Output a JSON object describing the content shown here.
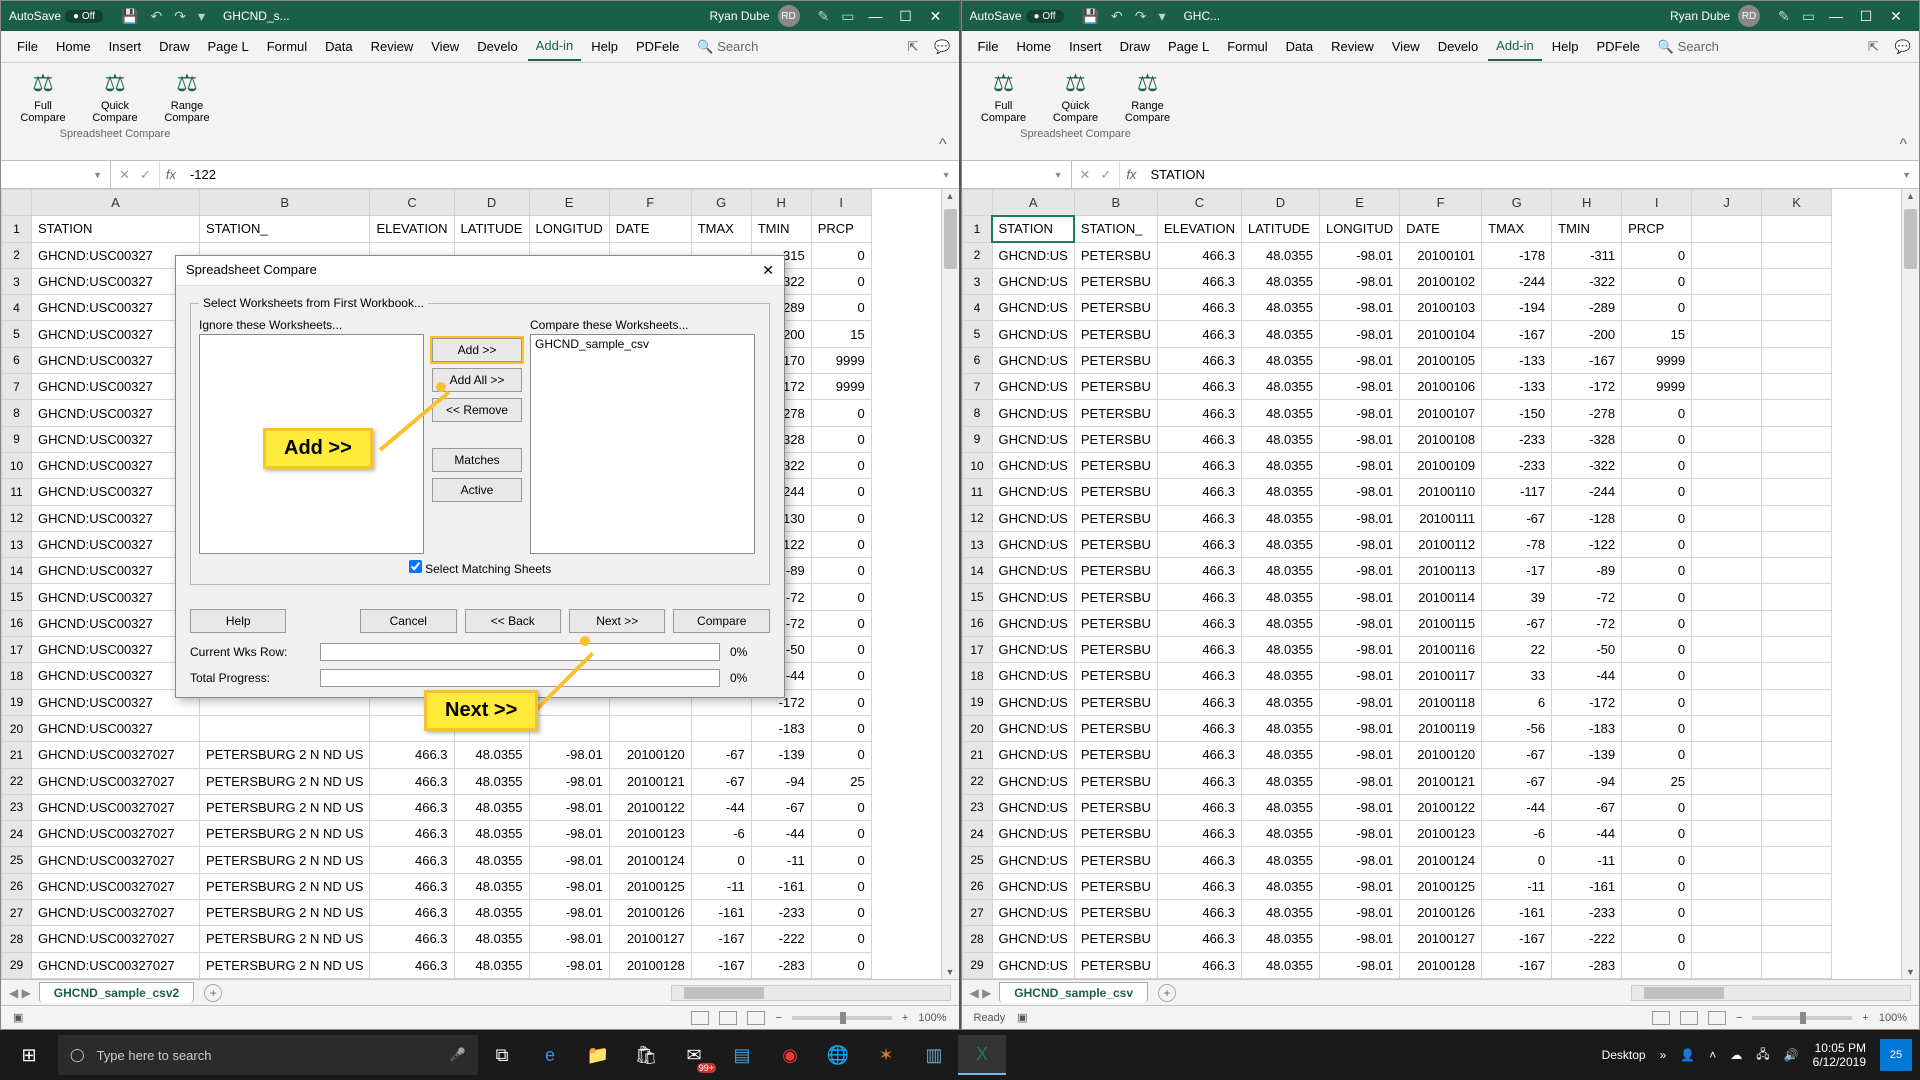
{
  "left_window": {
    "titlebar": {
      "autosave": "AutoSave",
      "autosave_state": "Off",
      "filename": "GHCND_s...",
      "username": "Ryan Dube",
      "avatar": "RD"
    },
    "tabs": [
      "File",
      "Home",
      "Insert",
      "Draw",
      "Page L",
      "Formul",
      "Data",
      "Review",
      "View",
      "Develo",
      "Add-in",
      "Help",
      "PDFele"
    ],
    "active_tab": "Add-in",
    "search_placeholder": "Search",
    "ribbon": {
      "buttons": [
        {
          "label": "Full Compare"
        },
        {
          "label": "Quick Compare"
        },
        {
          "label": "Range Compare"
        }
      ],
      "group_label": "Spreadsheet Compare"
    },
    "formula_value": "-122",
    "sheet_tab": "GHCND_sample_csv2",
    "zoom": "100%",
    "headers": [
      "STATION",
      "STATION_",
      "ELEVATION",
      "LATITUDE",
      "LONGITUD",
      "DATE",
      "TMAX",
      "TMIN",
      "PRCP"
    ],
    "cols": [
      "A",
      "B",
      "C",
      "D",
      "E",
      "F",
      "G",
      "H",
      "I"
    ],
    "partial_rows": [
      {
        "r": 2,
        "g": "",
        "h": -315,
        "i": 0
      },
      {
        "r": 3,
        "g": "",
        "h": -322,
        "i": 0
      },
      {
        "r": 4,
        "g": "",
        "h": -289,
        "i": 0
      },
      {
        "r": 5,
        "g": "",
        "h": -200,
        "i": 15
      },
      {
        "r": 6,
        "g": "",
        "h": -170,
        "i": 9999
      },
      {
        "r": 7,
        "g": "",
        "h": -172,
        "i": 9999
      },
      {
        "r": 8,
        "g": "",
        "h": -278,
        "i": 0
      },
      {
        "r": 9,
        "g": "",
        "h": -328,
        "i": 0
      },
      {
        "r": 10,
        "g": "",
        "h": -322,
        "i": 0
      },
      {
        "r": 11,
        "g": "",
        "h": -244,
        "i": 0
      },
      {
        "r": 12,
        "g": "",
        "h": -130,
        "i": 0
      },
      {
        "r": 13,
        "g": "",
        "h": -122,
        "i": 0
      },
      {
        "r": 14,
        "g": "",
        "h": -89,
        "i": 0
      },
      {
        "r": 15,
        "g": "",
        "h": -72,
        "i": 0
      },
      {
        "r": 16,
        "g": "",
        "h": -72,
        "i": 0
      },
      {
        "r": 17,
        "g": "",
        "h": -50,
        "i": 0
      },
      {
        "r": 18,
        "g": "",
        "h": -44,
        "i": 0
      },
      {
        "r": 19,
        "g": "",
        "h": -172,
        "i": 0
      },
      {
        "r": 20,
        "g": "",
        "h": -183,
        "i": 0
      }
    ],
    "full_rows": [
      {
        "r": 21,
        "a": "GHCND:USC00327027",
        "b": "PETERSBURG 2 N ND US",
        "c": 466.3,
        "d": 48.0355,
        "e": -98.01,
        "f": 20100120,
        "g": -67,
        "h": -139,
        "i": 0
      },
      {
        "r": 22,
        "a": "GHCND:USC00327027",
        "b": "PETERSBURG 2 N ND US",
        "c": 466.3,
        "d": 48.0355,
        "e": -98.01,
        "f": 20100121,
        "g": -67,
        "h": -94,
        "i": 25
      },
      {
        "r": 23,
        "a": "GHCND:USC00327027",
        "b": "PETERSBURG 2 N ND US",
        "c": 466.3,
        "d": 48.0355,
        "e": -98.01,
        "f": 20100122,
        "g": -44,
        "h": -67,
        "i": 0
      },
      {
        "r": 24,
        "a": "GHCND:USC00327027",
        "b": "PETERSBURG 2 N ND US",
        "c": 466.3,
        "d": 48.0355,
        "e": -98.01,
        "f": 20100123,
        "g": -6,
        "h": -44,
        "i": 0
      },
      {
        "r": 25,
        "a": "GHCND:USC00327027",
        "b": "PETERSBURG 2 N ND US",
        "c": 466.3,
        "d": 48.0355,
        "e": -98.01,
        "f": 20100124,
        "g": 0,
        "h": -11,
        "i": 0
      },
      {
        "r": 26,
        "a": "GHCND:USC00327027",
        "b": "PETERSBURG 2 N ND US",
        "c": 466.3,
        "d": 48.0355,
        "e": -98.01,
        "f": 20100125,
        "g": -11,
        "h": -161,
        "i": 0
      },
      {
        "r": 27,
        "a": "GHCND:USC00327027",
        "b": "PETERSBURG 2 N ND US",
        "c": 466.3,
        "d": 48.0355,
        "e": -98.01,
        "f": 20100126,
        "g": -161,
        "h": -233,
        "i": 0
      },
      {
        "r": 28,
        "a": "GHCND:USC00327027",
        "b": "PETERSBURG 2 N ND US",
        "c": 466.3,
        "d": 48.0355,
        "e": -98.01,
        "f": 20100127,
        "g": -167,
        "h": -222,
        "i": 0
      },
      {
        "r": 29,
        "a": "GHCND:USC00327027",
        "b": "PETERSBURG 2 N ND US",
        "c": 466.3,
        "d": 48.0355,
        "e": -98.01,
        "f": 20100128,
        "g": -167,
        "h": -283,
        "i": 0
      }
    ],
    "station_prefix": "GHCND:USC00327"
  },
  "right_window": {
    "titlebar": {
      "autosave": "AutoSave",
      "autosave_state": "Off",
      "filename": "GHC...",
      "username": "Ryan Dube",
      "avatar": "RD"
    },
    "formula_value": "STATION",
    "sheet_tab": "GHCND_sample_csv",
    "status": "Ready",
    "zoom": "100%",
    "headers": [
      "STATION",
      "STATION_",
      "ELEVATION",
      "LATITUDE",
      "LONGITUD",
      "DATE",
      "TMAX",
      "TMIN",
      "PRCP"
    ],
    "cols": [
      "A",
      "B",
      "C",
      "D",
      "E",
      "F",
      "G",
      "H",
      "I",
      "J",
      "K"
    ],
    "rows": [
      {
        "r": 2,
        "f": 20100101,
        "g": -178,
        "h": -311,
        "i": 0
      },
      {
        "r": 3,
        "f": 20100102,
        "g": -244,
        "h": -322,
        "i": 0
      },
      {
        "r": 4,
        "f": 20100103,
        "g": -194,
        "h": -289,
        "i": 0
      },
      {
        "r": 5,
        "f": 20100104,
        "g": -167,
        "h": -200,
        "i": 15
      },
      {
        "r": 6,
        "f": 20100105,
        "g": -133,
        "h": -167,
        "i": 9999
      },
      {
        "r": 7,
        "f": 20100106,
        "g": -133,
        "h": -172,
        "i": 9999
      },
      {
        "r": 8,
        "f": 20100107,
        "g": -150,
        "h": -278,
        "i": 0
      },
      {
        "r": 9,
        "f": 20100108,
        "g": -233,
        "h": -328,
        "i": 0
      },
      {
        "r": 10,
        "f": 20100109,
        "g": -233,
        "h": -322,
        "i": 0
      },
      {
        "r": 11,
        "f": 20100110,
        "g": -117,
        "h": -244,
        "i": 0
      },
      {
        "r": 12,
        "f": 20100111,
        "g": -67,
        "h": -128,
        "i": 0
      },
      {
        "r": 13,
        "f": 20100112,
        "g": -78,
        "h": -122,
        "i": 0
      },
      {
        "r": 14,
        "f": 20100113,
        "g": -17,
        "h": -89,
        "i": 0
      },
      {
        "r": 15,
        "f": 20100114,
        "g": 39,
        "h": -72,
        "i": 0
      },
      {
        "r": 16,
        "f": 20100115,
        "g": -67,
        "h": -72,
        "i": 0
      },
      {
        "r": 17,
        "f": 20100116,
        "g": 22,
        "h": -50,
        "i": 0
      },
      {
        "r": 18,
        "f": 20100117,
        "g": 33,
        "h": -44,
        "i": 0
      },
      {
        "r": 19,
        "f": 20100118,
        "g": 6,
        "h": -172,
        "i": 0
      },
      {
        "r": 20,
        "f": 20100119,
        "g": -56,
        "h": -183,
        "i": 0
      },
      {
        "r": 21,
        "f": 20100120,
        "g": -67,
        "h": -139,
        "i": 0
      },
      {
        "r": 22,
        "f": 20100121,
        "g": -67,
        "h": -94,
        "i": 25
      },
      {
        "r": 23,
        "f": 20100122,
        "g": -44,
        "h": -67,
        "i": 0
      },
      {
        "r": 24,
        "f": 20100123,
        "g": -6,
        "h": -44,
        "i": 0
      },
      {
        "r": 25,
        "f": 20100124,
        "g": 0,
        "h": -11,
        "i": 0
      },
      {
        "r": 26,
        "f": 20100125,
        "g": -11,
        "h": -161,
        "i": 0
      },
      {
        "r": 27,
        "f": 20100126,
        "g": -161,
        "h": -233,
        "i": 0
      },
      {
        "r": 28,
        "f": 20100127,
        "g": -167,
        "h": -222,
        "i": 0
      },
      {
        "r": 29,
        "f": 20100128,
        "g": -167,
        "h": -283,
        "i": 0
      }
    ],
    "common": {
      "a": "GHCND:US",
      "b": "PETERSBU",
      "c": 466.3,
      "d": 48.0355,
      "e": -98.01
    }
  },
  "dialog": {
    "title": "Spreadsheet Compare",
    "fieldset_legend": "Select Worksheets from First Workbook...",
    "ignore_label": "Ignore these Worksheets...",
    "compare_label": "Compare these Worksheets...",
    "compare_item": "GHCND_sample_csv",
    "btn_add": "Add >>",
    "btn_addall": "Add All >>",
    "btn_remove": "<< Remove",
    "btn_matches": "Matches",
    "btn_active": "Active",
    "chk_matching": "Select Matching Sheets",
    "btn_help": "Help",
    "btn_cancel": "Cancel",
    "btn_back": "<< Back",
    "btn_next": "Next >>",
    "btn_compare": "Compare",
    "row_label": "Current Wks Row:",
    "total_label": "Total Progress:",
    "pct": "0%"
  },
  "callouts": {
    "add": "Add >>",
    "next": "Next >>"
  },
  "taskbar": {
    "search_placeholder": "Type here to search",
    "desktop": "Desktop",
    "time": "10:05 PM",
    "date": "6/12/2019",
    "notif_count": "25",
    "mail_badge": "99+"
  }
}
